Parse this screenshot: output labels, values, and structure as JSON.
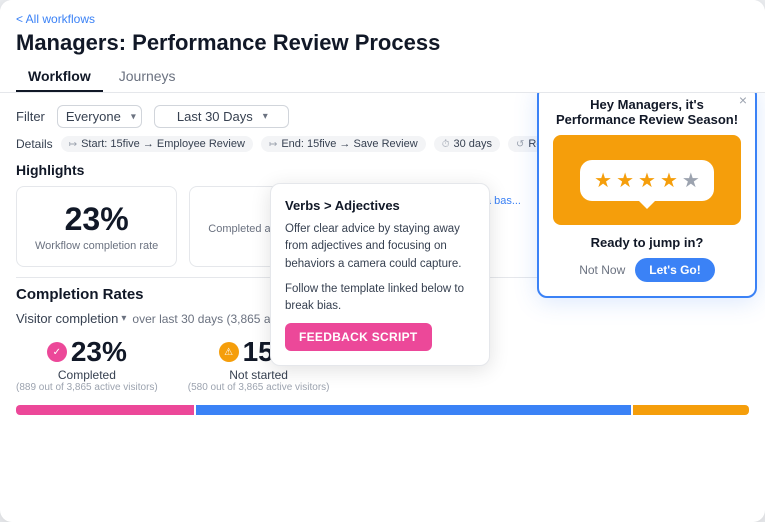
{
  "nav": {
    "back_label": "< All workflows"
  },
  "page": {
    "title": "Managers: Performance Review Process"
  },
  "tabs": [
    {
      "id": "workflow",
      "label": "Workflow",
      "active": true
    },
    {
      "id": "journeys",
      "label": "Journeys",
      "active": false
    }
  ],
  "filter": {
    "label": "Filter",
    "audience": "Everyone",
    "date_range": "Last 30 Days"
  },
  "details": {
    "label": "Details",
    "start": "Start: 15five → Employee Review",
    "end": "End: 15five → Save Review",
    "duration": "30 days",
    "recurrence": "Recurr..."
  },
  "highlights": {
    "title": "Highlights",
    "completion_rate": {
      "value": "23%",
      "label": "Workflow completion rate"
    },
    "completed_attempts": {
      "label": "Completed attempts"
    }
  },
  "completion": {
    "title": "Completion Rates",
    "visitor_label": "Visitor completion",
    "visitor_sub": "over last 30 days (3,865 activ...",
    "stats": [
      {
        "id": "completed",
        "value": "23%",
        "label": "Completed",
        "sub": "(889 out of 3,865 active visitors)",
        "icon_color": "pink",
        "icon": "✓"
      },
      {
        "id": "not_started",
        "value": "15%",
        "label": "Not started",
        "sub": "(580 out of 3,865 active visitors)",
        "icon_color": "orange",
        "icon": "⚠"
      }
    ],
    "bars": [
      {
        "label": "pink",
        "flex": 23
      },
      {
        "label": "blue",
        "flex": 56
      },
      {
        "label": "orange",
        "flex": 15
      }
    ]
  },
  "verbs_card": {
    "title": "Verbs > Adjectives",
    "body1": "Offer clear advice by staying away from adjectives and focusing on behaviors a camera could capture.",
    "body2": "Follow the template linked below to break bias.",
    "button_label": "FEEDBACK SCRIPT"
  },
  "notif_popup": {
    "header": "Hey Managers, it's Performance Review Season!",
    "cta": "Ready to jump in?",
    "not_now": "Not Now",
    "lets_go": "Let's Go!",
    "stars": [
      "★",
      "★",
      "★",
      "★",
      "★"
    ],
    "close": "×"
  },
  "set_baseline": "st a bas..."
}
